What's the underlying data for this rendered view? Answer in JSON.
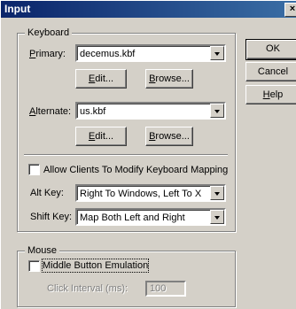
{
  "window": {
    "title": "Input",
    "close_glyph": "×"
  },
  "buttons": {
    "ok": "OK",
    "cancel": "Cancel",
    "help_prefix": "",
    "help_u": "H",
    "help_rest": "elp"
  },
  "keyboard": {
    "group_label": "Keyboard",
    "primary_u": "P",
    "primary_rest": "rimary:",
    "primary_value": "decemus.kbf",
    "alternate_pre": "",
    "alternate_u": "A",
    "alternate_rest": "lternate:",
    "alternate_value": "us.kbf",
    "edit_u": "E",
    "edit_rest": "dit...",
    "browse_u": "B",
    "browse_rest": "rowse...",
    "allow_clients_label": "Allow Clients To Modify Keyboard Mapping",
    "allow_clients_checked": false,
    "alt_key_label": "Alt Key:",
    "alt_key_value": "Right To Windows, Left To X",
    "shift_key_label": "Shift Key:",
    "shift_key_value": "Map Both Left and Right"
  },
  "mouse": {
    "group_label": "Mouse",
    "middle_button_label": "Middle Button Emulation",
    "middle_button_checked": false,
    "click_interval_label": "Click Interval (ms):",
    "click_interval_value": "100"
  }
}
